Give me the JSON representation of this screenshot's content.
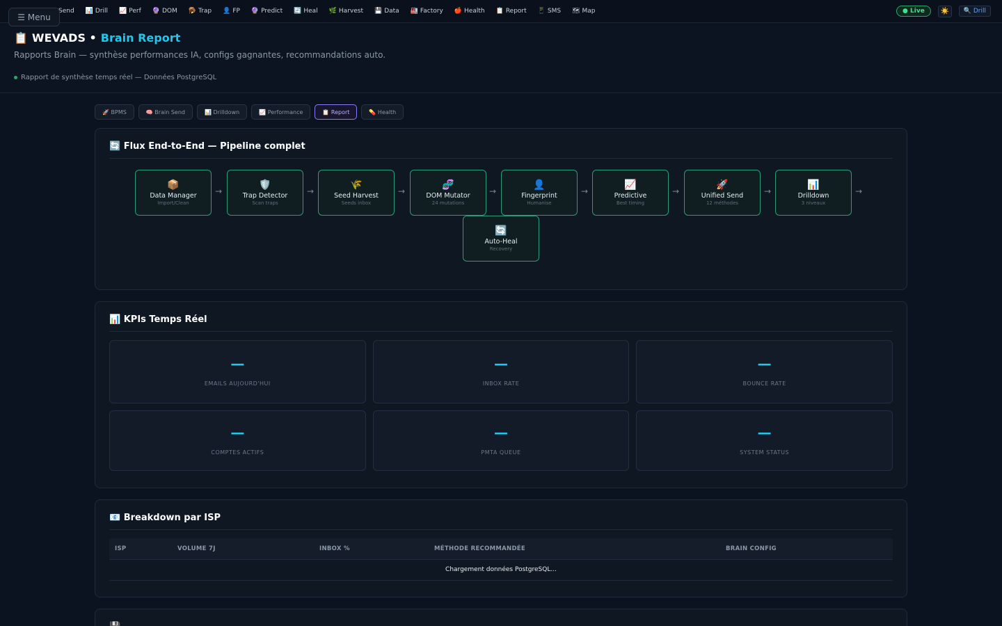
{
  "topnav": {
    "items": [
      {
        "icon": "🚀",
        "label": "Send"
      },
      {
        "icon": "📊",
        "label": "Drill"
      },
      {
        "icon": "📈",
        "label": "Perf"
      },
      {
        "icon": "🔮",
        "label": "DOM"
      },
      {
        "icon": "🪤",
        "label": "Trap"
      },
      {
        "icon": "👤",
        "label": "FP"
      },
      {
        "icon": "🔮",
        "label": "Predict"
      },
      {
        "icon": "🔄",
        "label": "Heal"
      },
      {
        "icon": "🌿",
        "label": "Harvest"
      },
      {
        "icon": "💾",
        "label": "Data"
      },
      {
        "icon": "🏭",
        "label": "Factory"
      },
      {
        "icon": "🍎",
        "label": "Health"
      },
      {
        "icon": "📋",
        "label": "Report"
      },
      {
        "icon": "📱",
        "label": "SMS"
      },
      {
        "icon": "🗺",
        "label": "Map"
      }
    ],
    "live": "● Live",
    "theme_icon": "☀️",
    "drill": "🔍 Drill",
    "menu": "☰ Menu"
  },
  "header": {
    "icon": "📋",
    "title_main": "WEVADS •",
    "title_accent": "Brain Report",
    "subtitle": "Rapports Brain — synthèse performances IA, configs gagnantes, recommandations auto.",
    "status": "Rapport de synthèse temps réel — Données PostgreSQL"
  },
  "tabs": [
    {
      "label": "🚀 BPMS",
      "active": false
    },
    {
      "label": "🧠 Brain Send",
      "active": false
    },
    {
      "label": "📊 Drilldown",
      "active": false
    },
    {
      "label": "📈 Performance",
      "active": false
    },
    {
      "label": "📋 Report",
      "active": true
    },
    {
      "label": "💊 Health",
      "active": false
    }
  ],
  "pipeline": {
    "title": "🔄 Flux End-to-End — Pipeline complet",
    "nodes": [
      {
        "icon": "📦",
        "name": "Data Manager",
        "sub": "Import/Clean"
      },
      {
        "icon": "🛡️",
        "name": "Trap Detector",
        "sub": "Scan traps"
      },
      {
        "icon": "🌾",
        "name": "Seed Harvest",
        "sub": "Seeds inbox"
      },
      {
        "icon": "🧬",
        "name": "DOM Mutator",
        "sub": "24 mutations"
      },
      {
        "icon": "👤",
        "name": "Fingerprint",
        "sub": "Humanise"
      },
      {
        "icon": "📈",
        "name": "Predictive",
        "sub": "Best timing"
      },
      {
        "icon": "🚀",
        "name": "Unified Send",
        "sub": "12 méthodes"
      },
      {
        "icon": "📊",
        "name": "Drilldown",
        "sub": "3 niveaux"
      },
      {
        "icon": "🔄",
        "name": "Auto-Heal",
        "sub": "Recovery"
      }
    ],
    "arrow": "→"
  },
  "kpis": {
    "title": "📊 KPIs Temps Réel",
    "items": [
      {
        "value": "—",
        "label": "EMAILS AUJOURD'HUI"
      },
      {
        "value": "—",
        "label": "INBOX RATE"
      },
      {
        "value": "—",
        "label": "BOUNCE RATE"
      },
      {
        "value": "—",
        "label": "COMPTES ACTIFS"
      },
      {
        "value": "—",
        "label": "PMTA QUEUE"
      },
      {
        "value": "—",
        "label": "SYSTEM STATUS"
      }
    ]
  },
  "isp": {
    "title": "📧 Breakdown par ISP",
    "columns": [
      "ISP",
      "VOLUME 7J",
      "INBOX %",
      "MÉTHODE RECOMMANDÉE",
      "BRAIN CONFIG"
    ],
    "loading": "Chargement données PostgreSQL..."
  },
  "next_panel": {
    "title": "💾"
  }
}
